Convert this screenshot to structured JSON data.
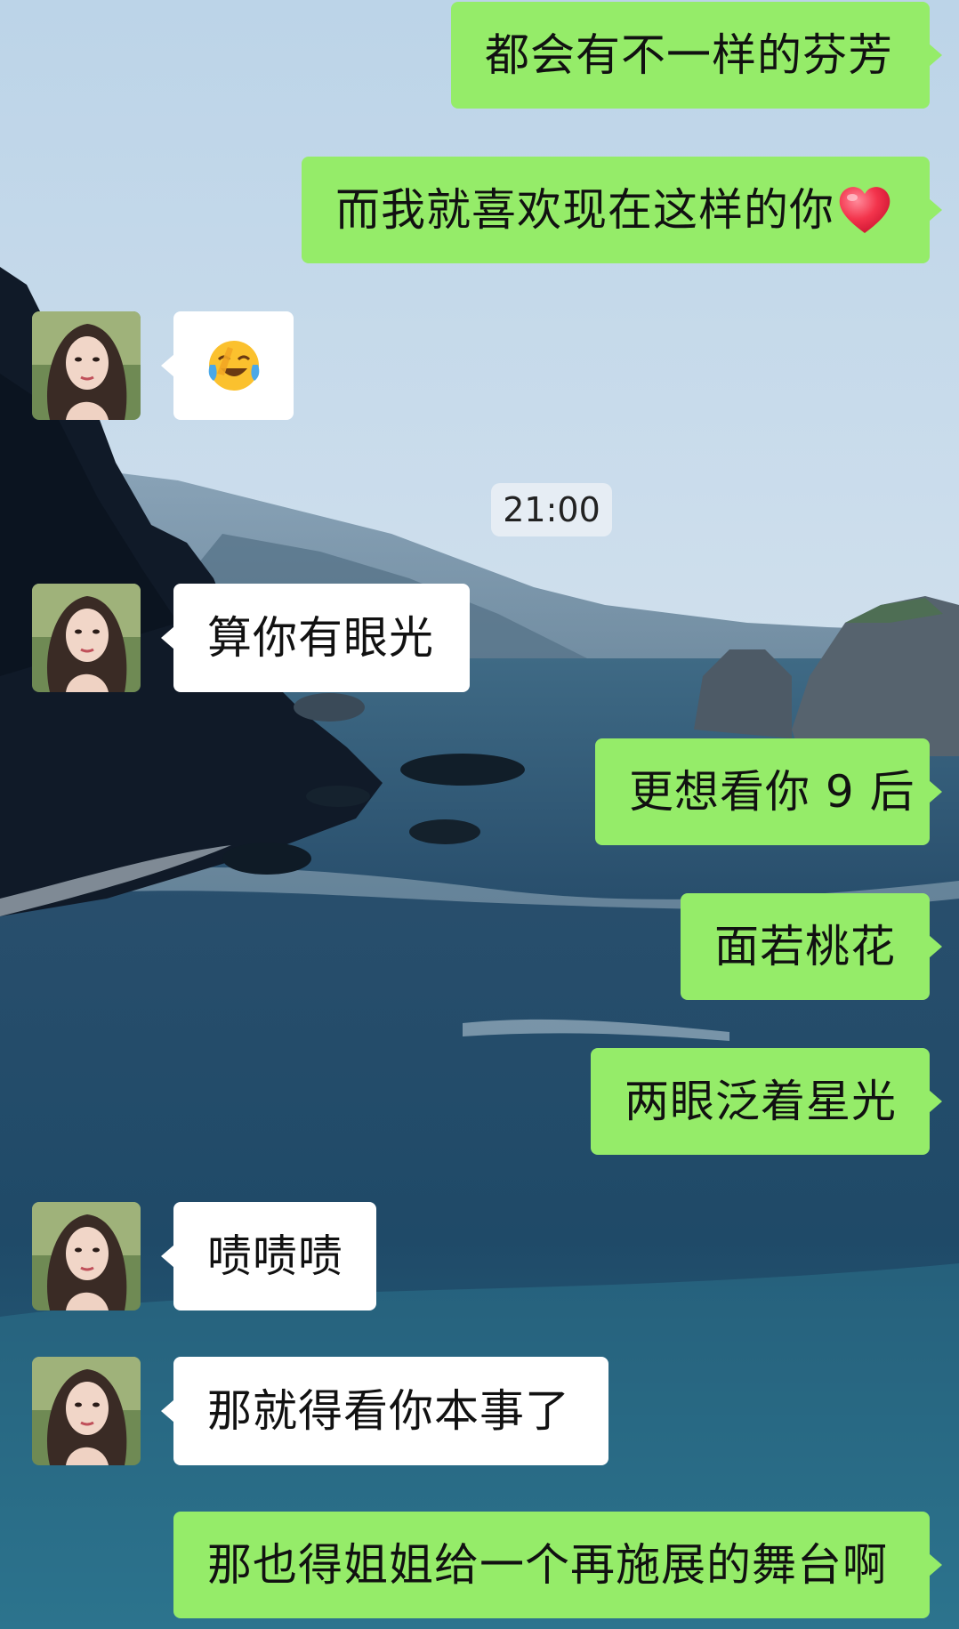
{
  "colors": {
    "outgoing_bubble": "#95ec69",
    "incoming_bubble": "#ffffff",
    "text": "#111111",
    "timestamp_bg": "#ebf0f5"
  },
  "chat": {
    "timestamp": "21:00",
    "messages": [
      {
        "direction": "outgoing",
        "text": "都会有不一样的芬芳"
      },
      {
        "direction": "outgoing",
        "text": "而我就喜欢现在这样的你",
        "icon": "red-heart-icon"
      },
      {
        "direction": "incoming",
        "text": "😭",
        "icon": "crying-laughing-emoji"
      },
      {
        "direction": "incoming",
        "text": "算你有眼光"
      },
      {
        "direction": "outgoing",
        "text": "更想看你 9 后"
      },
      {
        "direction": "outgoing",
        "text": "面若桃花"
      },
      {
        "direction": "outgoing",
        "text": "两眼泛着星光"
      },
      {
        "direction": "incoming",
        "text": "啧啧啧"
      },
      {
        "direction": "incoming",
        "text": "那就得看你本事了"
      },
      {
        "direction": "outgoing",
        "text": "那也得姐姐给一个再施展的舞台啊"
      }
    ]
  }
}
